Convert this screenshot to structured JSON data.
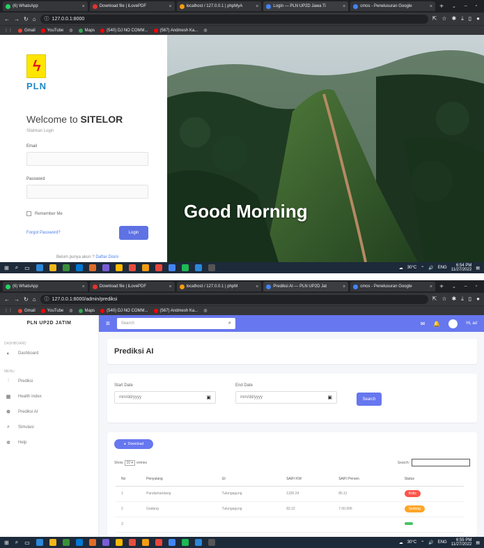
{
  "browser1": {
    "tabs": [
      {
        "label": "(6) WhatsApp",
        "color": "#25d366"
      },
      {
        "label": "Download file | iLovePDF",
        "color": "#e5322d"
      },
      {
        "label": "localhost / 127.0.0.1 | phpMyA",
        "color": "#f89c0e"
      },
      {
        "label": "Login — PLN UP2D Jawa Ti",
        "color": "#4285f4"
      },
      {
        "label": "cmos - Penelusuran Google",
        "color": "#4285f4"
      }
    ],
    "url": "127.0.0.1:8000",
    "bookmarks": [
      "Gmail",
      "YouTube",
      "",
      "Maps",
      "(540) DJ NO COMM...",
      "(567) Andmesh Ka..."
    ]
  },
  "browser2": {
    "tabs": [
      {
        "label": "(6) WhatsApp",
        "color": "#25d366"
      },
      {
        "label": "Download file | iLovePDF",
        "color": "#e5322d"
      },
      {
        "label": "localhost / 127.0.0.1 | phpM",
        "color": "#f89c0e"
      },
      {
        "label": "Prediksi AI — PLN UP2D Jat",
        "color": "#4285f4"
      },
      {
        "label": "cmos - Penelusuran Google",
        "color": "#4285f4"
      }
    ],
    "url": "127.0.0.1:8000/admin/prediksi",
    "bookmarks": [
      "Gmail",
      "YouTube",
      "",
      "Maps",
      "(540) DJ NO COMM...",
      "(567) Andmesh Ka..."
    ]
  },
  "login": {
    "brand": "PLN",
    "welcome_prefix": "Welcome to ",
    "welcome_app": "SITELOR",
    "subtitle": "Silahkan Login",
    "email_label": "Email",
    "password_label": "Password",
    "remember_label": "Remember Me",
    "forgot_label": "Forgot Password?",
    "login_button": "Login",
    "register_text": "Belum punya akun ?",
    "register_link": "Daftar Disini",
    "greeting": "Good Morning"
  },
  "dashboard": {
    "brand": "PLN UP2D JATIM",
    "search_placeholder": "Search",
    "user_label": "Hi, ad",
    "sections": {
      "dashboard": "DASHBOARD",
      "menu": "MENU"
    },
    "nav": [
      {
        "label": "Dashboard",
        "icon": "gauge-icon",
        "glyph": "◐"
      },
      {
        "label": "Prediksi",
        "icon": "chart-icon",
        "glyph": "⫶"
      },
      {
        "label": "Health Index",
        "icon": "grid-icon",
        "glyph": "▦"
      },
      {
        "label": "Prediksi AI",
        "icon": "brain-icon",
        "glyph": "❁"
      },
      {
        "label": "Simulasi",
        "icon": "search-icon",
        "glyph": "⌕"
      },
      {
        "label": "Help",
        "icon": "settings-icon",
        "glyph": "✲"
      }
    ],
    "page_title": "Prediksi AI",
    "start_label": "Start Date",
    "end_label": "End Date",
    "date_placeholder": "mm/dd/yyyy",
    "search_button": "Search",
    "download_button": "Download",
    "show_prefix": "Show",
    "show_value": "10",
    "show_suffix": "entries",
    "table_search_label": "Search:",
    "columns": [
      "No",
      "Penyulang",
      "GI",
      "SAIFI KW",
      "SAIFI Persen",
      "Status"
    ],
    "rows": [
      {
        "no": "1",
        "penyulang": "Pandantandang",
        "gi": "Tulungagung",
        "kw": "1335.24",
        "persen": "85.11",
        "status": "Kritis",
        "status_color": "#fc544b"
      },
      {
        "no": "2",
        "penyulang": "Gadang",
        "gi": "Tulungagung",
        "kw": "82.22",
        "persen": "7.00.006",
        "status": "Sedang",
        "status_color": "#ffa426"
      },
      {
        "no": "3",
        "penyulang": "",
        "gi": "",
        "kw": "",
        "persen": "",
        "status": "",
        "status_color": "#47c363"
      }
    ]
  },
  "taskbar1": {
    "temp": "30°C",
    "lang": "ENG",
    "time": "6:54 PM",
    "date": "11/27/2022"
  },
  "taskbar2": {
    "temp": "30°C",
    "lang": "ENG",
    "time": "6:55 PM",
    "date": "11/27/2022"
  },
  "colors": {
    "accent": "#6777ef",
    "chrome": "#202124",
    "taskbar": "#1d2a3a",
    "pln_yellow": "#ffe500",
    "pln_blue": "#1e88c8"
  }
}
